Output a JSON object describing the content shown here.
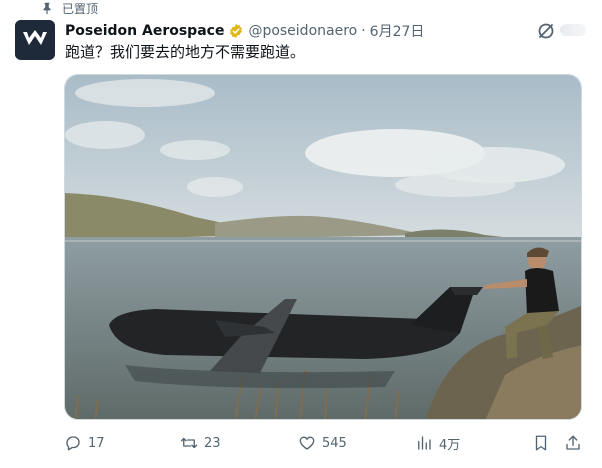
{
  "pinned": {
    "label": "已置顶",
    "icon": "pin-icon"
  },
  "author": {
    "name": "Poseidon Aerospace",
    "handle": "@poseidonaero",
    "separator": "·",
    "date": "6月27日",
    "verified_icon": "verified-badge-icon",
    "avatar_icon": "w-logo-icon"
  },
  "tweet": {
    "text": "跑道？我们要去的地方不需要跑道。"
  },
  "media": {
    "description_icon": "seaplane-photo"
  },
  "actions": {
    "reply": {
      "icon": "reply-icon",
      "count": "17"
    },
    "repost": {
      "icon": "repost-icon",
      "count": "23"
    },
    "like": {
      "icon": "heart-icon",
      "count": "545"
    },
    "views": {
      "icon": "analytics-icon",
      "count": "4万"
    },
    "bookmark": {
      "icon": "bookmark-icon"
    },
    "share": {
      "icon": "share-icon"
    }
  },
  "colors": {
    "text": "#0f1419",
    "muted": "#536471",
    "verified": "#e2b719",
    "border": "#cfd9de"
  }
}
